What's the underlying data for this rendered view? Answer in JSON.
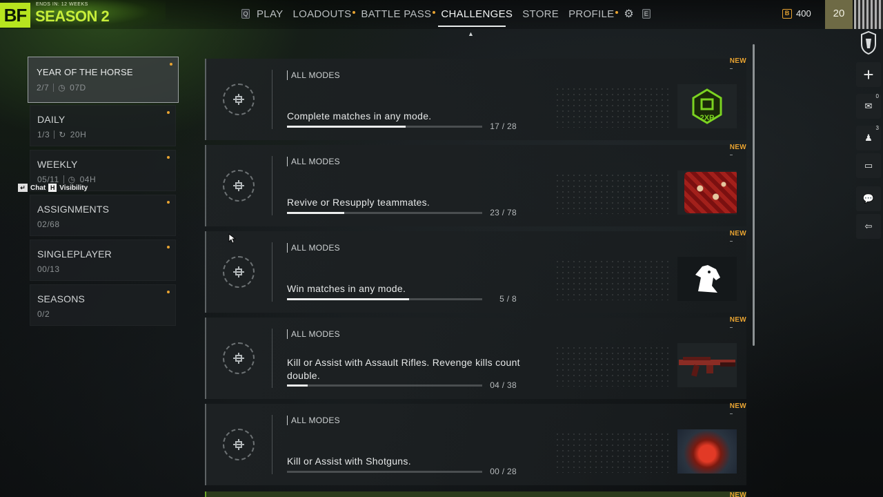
{
  "header": {
    "season_sub": "ENDS IN: 12 WEEKS",
    "season_title": "SEASON 2",
    "logo_text": "BF",
    "nav_left_key": "Q",
    "nav_right_key": "E",
    "nav": [
      {
        "label": "PLAY",
        "dot": false,
        "active": false
      },
      {
        "label": "LOADOUTS",
        "dot": true,
        "active": false
      },
      {
        "label": "BATTLE PASS",
        "dot": true,
        "active": false
      },
      {
        "label": "CHALLENGES",
        "dot": false,
        "active": true
      },
      {
        "label": "STORE",
        "dot": false,
        "active": false
      },
      {
        "label": "PROFILE",
        "dot": true,
        "active": false
      }
    ],
    "currency_amount": "400",
    "currency_symbol": "B",
    "player_level": "20"
  },
  "categories": [
    {
      "name": "YEAR OF THE HORSE",
      "progress": "2/7",
      "extra": "07D",
      "active": true
    },
    {
      "name": "DAILY",
      "progress": "1/3",
      "extra": "20H",
      "active": false
    },
    {
      "name": "WEEKLY",
      "progress": "05/11",
      "extra": "04H",
      "active": false
    },
    {
      "name": "ASSIGNMENTS",
      "progress": "02/68",
      "extra": "",
      "active": false
    },
    {
      "name": "SINGLEPLAYER",
      "progress": "00/13",
      "extra": "",
      "active": false
    },
    {
      "name": "SEASONS",
      "progress": "0/2",
      "extra": "",
      "active": false
    }
  ],
  "chat_hint": {
    "chat_label": "Chat",
    "key": "H",
    "visibility_label": "Visibility"
  },
  "challenges": [
    {
      "mode": "ALL MODES",
      "description": "Complete matches in any mode.",
      "current": 17,
      "total": 28,
      "count_text": "17 / 28",
      "new_label": "NEW",
      "reward": "2xp-token"
    },
    {
      "mode": "ALL MODES",
      "description": "Revive or Resupply teammates.",
      "current": 23,
      "total": 78,
      "count_text": "23 / 78",
      "new_label": "NEW",
      "reward": "red-cloth"
    },
    {
      "mode": "ALL MODES",
      "description": "Win matches in any mode.",
      "current": 5,
      "total": 8,
      "count_text": "5 / 8",
      "new_label": "NEW",
      "reward": "horse-emblem"
    },
    {
      "mode": "ALL MODES",
      "description": "Kill or Assist with Assault Rifles. Revenge kills count double.",
      "current": 4,
      "total": 38,
      "count_text": "04 / 38",
      "new_label": "NEW",
      "reward": "rifle-skin"
    },
    {
      "mode": "ALL MODES",
      "description": "Kill or Assist with Shotguns.",
      "current": 0,
      "total": 28,
      "count_text": "00 / 28",
      "new_label": "NEW",
      "reward": "red-orb"
    }
  ],
  "partial_card": {
    "new_label": "NEW"
  },
  "reward_token_text": "2XP",
  "rail": {
    "mail_count": "0",
    "squad_count": "3"
  }
}
